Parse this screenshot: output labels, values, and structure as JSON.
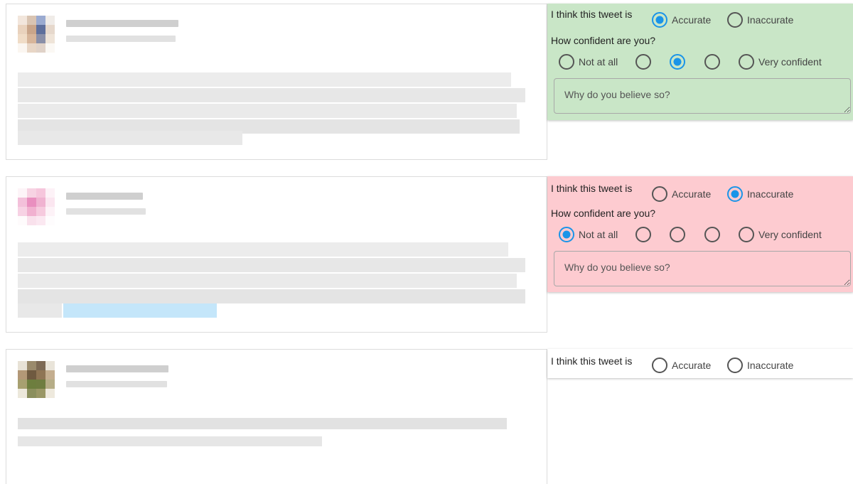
{
  "tweets": [
    {
      "author": "",
      "handle": ""
    },
    {
      "author": "",
      "handle": ""
    },
    {
      "author": "",
      "handle": ""
    }
  ],
  "form": {
    "think_label": "I think this tweet is",
    "accurate_label": "Accurate",
    "inaccurate_label": "Inaccurate",
    "confidence_label": "How confident are you?",
    "not_at_all_label": "Not at all",
    "very_confident_label": "Very confident",
    "why_placeholder": "Why do you believe so?"
  },
  "responses": [
    {
      "judgement": "Accurate",
      "confidence_level": 3,
      "panel_color": "#c9e6c7"
    },
    {
      "judgement": "Inaccurate",
      "confidence_level": 1,
      "panel_color": "#fdcbd0"
    },
    {
      "judgement": null,
      "confidence_level": null,
      "panel_color": "#ffffff"
    }
  ],
  "colors": {
    "accent": "#1a94e8"
  }
}
